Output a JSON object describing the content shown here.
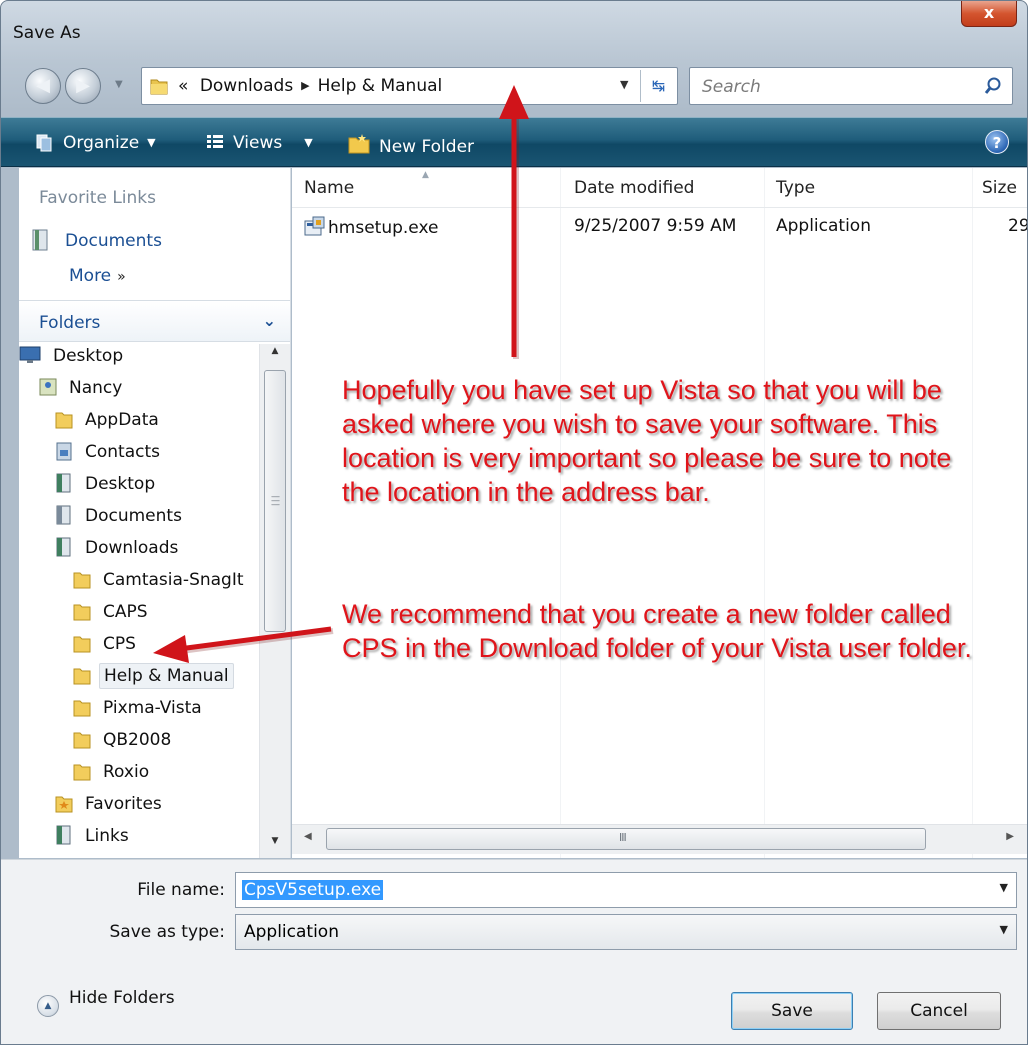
{
  "window": {
    "title": "Save As",
    "close_label": "x"
  },
  "address_bar": {
    "overflow": "«",
    "crumbs": [
      "Downloads",
      "Help & Manual"
    ],
    "search_placeholder": "Search"
  },
  "toolbar": {
    "organize": "Organize",
    "views": "Views",
    "new_folder": "New Folder",
    "help": "?"
  },
  "favorite_links": {
    "header": "Favorite Links",
    "items": [
      "Documents"
    ],
    "more": "More",
    "more_chevron": "»"
  },
  "folders": {
    "header": "Folders",
    "tree": [
      {
        "label": "Desktop",
        "icon": "desktop-icon"
      },
      {
        "label": "Nancy",
        "icon": "user-folder-icon"
      },
      {
        "label": "AppData",
        "icon": "folder-icon"
      },
      {
        "label": "Contacts",
        "icon": "contacts-icon"
      },
      {
        "label": "Desktop",
        "icon": "library-folder-icon"
      },
      {
        "label": "Documents",
        "icon": "library-folder-icon"
      },
      {
        "label": "Downloads",
        "icon": "library-folder-icon"
      },
      {
        "label": "Camtasia-SnagIt",
        "icon": "folder-icon"
      },
      {
        "label": "CAPS",
        "icon": "folder-icon"
      },
      {
        "label": "CPS",
        "icon": "folder-icon"
      },
      {
        "label": "Help & Manual",
        "icon": "folder-icon",
        "selected": true
      },
      {
        "label": "Pixma-Vista",
        "icon": "folder-icon"
      },
      {
        "label": "QB2008",
        "icon": "folder-icon"
      },
      {
        "label": "Roxio",
        "icon": "folder-icon"
      },
      {
        "label": "Favorites",
        "icon": "favorites-icon"
      },
      {
        "label": "Links",
        "icon": "library-folder-icon"
      }
    ]
  },
  "file_list": {
    "columns": [
      "Name",
      "Date modified",
      "Type",
      "Size"
    ],
    "rows": [
      {
        "name": "hmsetup.exe",
        "date_modified": "9/25/2007 9:59 AM",
        "type": "Application",
        "size": "29"
      }
    ],
    "scroll_grip": "III"
  },
  "form": {
    "file_name_label": "File name:",
    "file_name_value": "CpsV5setup.exe",
    "save_as_type_label": "Save as type:",
    "save_as_type_value": "Application",
    "hide_folders": "Hide Folders",
    "save_button": "Save",
    "cancel_button": "Cancel"
  },
  "annotations": {
    "note_1": "Hopefully you have set up Vista so that you will be asked where you wish to save your software.  This location is very important so please be sure to note the location in the address bar.",
    "note_2": "We recommend that you create a new folder called CPS in the Download folder of your Vista user folder.",
    "color": "#e0141a"
  },
  "colors": {
    "toolbar": "#1f5d7b",
    "link": "#1b4f93",
    "selection": "#3399ff"
  }
}
